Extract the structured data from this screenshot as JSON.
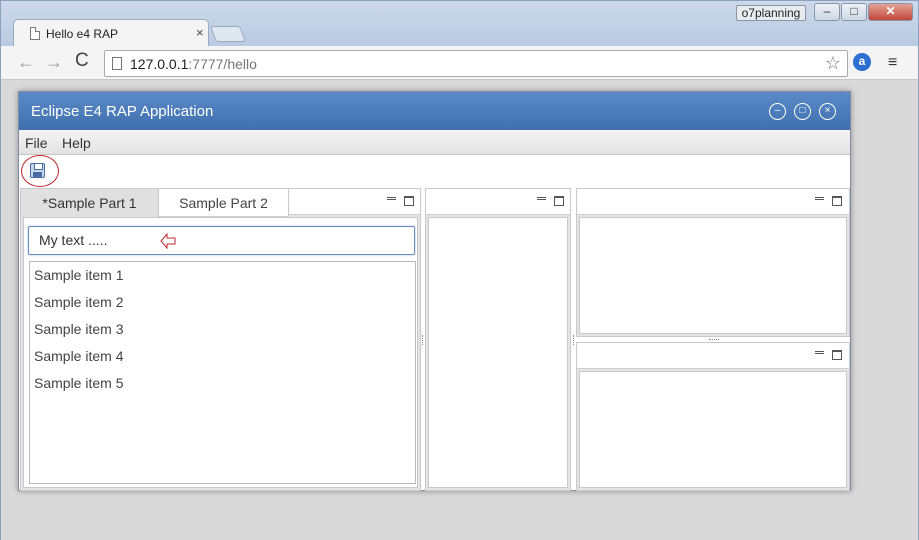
{
  "browser": {
    "tab_title": "Hello e4 RAP",
    "tab_close": "×",
    "profile_label": "o7planning",
    "win_min": "–",
    "win_max": "□",
    "win_close": "✕",
    "nav_back": "←",
    "nav_forward": "→",
    "nav_reload": "C",
    "url_host": "127.0.0.1",
    "url_rest": ":7777/hello",
    "star": "☆",
    "ext_icon": "a",
    "menu_icon": "≡"
  },
  "app": {
    "title": "Eclipse E4 RAP Application",
    "title_controls": {
      "minimize": "–",
      "maximize": "□",
      "close": "×"
    },
    "menu": [
      "File",
      "Help"
    ],
    "toolbar": {
      "save_icon": "save-icon"
    },
    "left_pane": {
      "tabs": [
        "*Sample Part 1",
        "Sample Part 2"
      ],
      "text_field_value": "My text .....",
      "list_items": [
        "Sample item 1",
        "Sample item 2",
        "Sample item 3",
        "Sample item 4",
        "Sample item 5"
      ]
    }
  },
  "colors": {
    "app_title_bar": "#4f7fbd",
    "annotation_red": "#c0262c",
    "focus_border": "#6a8ebf"
  }
}
